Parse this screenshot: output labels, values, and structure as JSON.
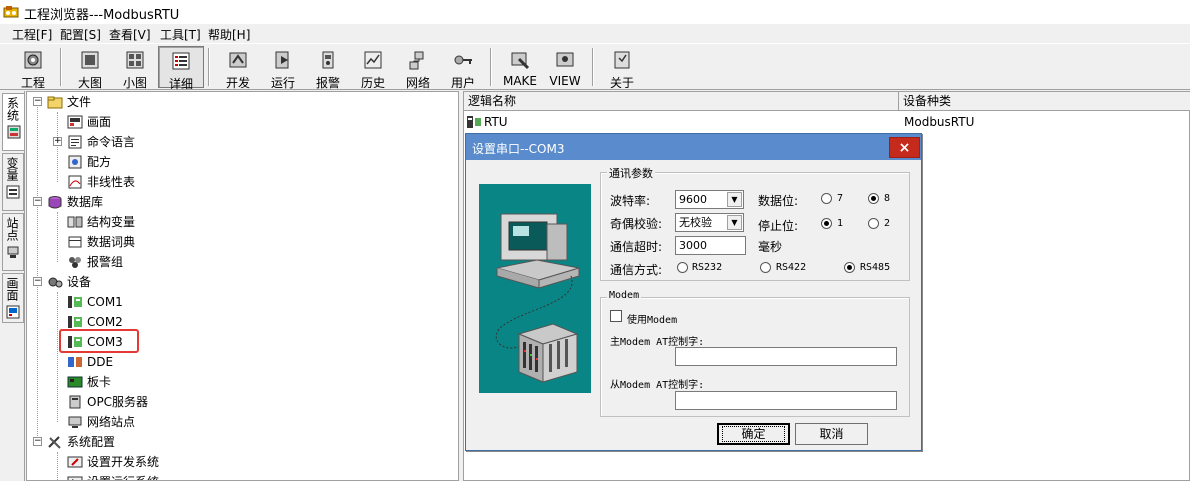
{
  "window": {
    "title": "工程浏览器---ModbusRTU",
    "app_icon": "app-logo-icon"
  },
  "menu": [
    "工程[F]",
    "配置[S]",
    "查看[V]",
    "工具[T]",
    "帮助[H]"
  ],
  "toolbar": {
    "buttons": [
      {
        "label": "工程",
        "icon": "project-icon"
      },
      {
        "label": "大图",
        "icon": "large-icons-icon"
      },
      {
        "label": "小图",
        "icon": "small-icons-icon"
      },
      {
        "label": "详细",
        "icon": "details-icon",
        "pressed": true
      },
      {
        "label": "开发",
        "icon": "develop-icon"
      },
      {
        "label": "运行",
        "icon": "run-icon"
      },
      {
        "label": "报警",
        "icon": "alarm-icon"
      },
      {
        "label": "历史",
        "icon": "history-icon"
      },
      {
        "label": "网络",
        "icon": "network-icon"
      },
      {
        "label": "用户",
        "icon": "user-key-icon"
      },
      {
        "label": "MAKE",
        "icon": "make-icon"
      },
      {
        "label": "VIEW",
        "icon": "view-icon"
      },
      {
        "label": "关于",
        "icon": "about-icon"
      }
    ]
  },
  "vtabs": [
    {
      "label": "系统",
      "icon": "system-tab-icon",
      "active": true
    },
    {
      "label": "变量",
      "icon": "variable-tab-icon"
    },
    {
      "label": "站点",
      "icon": "station-tab-icon"
    },
    {
      "label": "画面",
      "icon": "screen-tab-icon"
    }
  ],
  "tree": {
    "items": [
      {
        "label": "文件",
        "icon": "folder-icon",
        "level": 0,
        "expander": "−"
      },
      {
        "label": "画面",
        "icon": "screen-icon",
        "level": 1
      },
      {
        "label": "命令语言",
        "icon": "command-language-icon",
        "level": 1,
        "expander": "+"
      },
      {
        "label": "配方",
        "icon": "recipe-icon",
        "level": 1
      },
      {
        "label": "非线性表",
        "icon": "nonlinear-table-icon",
        "level": 1
      },
      {
        "label": "数据库",
        "icon": "database-icon",
        "level": 0,
        "expander": "−"
      },
      {
        "label": "结构变量",
        "icon": "struct-variable-icon",
        "level": 1
      },
      {
        "label": "数据词典",
        "icon": "data-dictionary-icon",
        "level": 1
      },
      {
        "label": "报警组",
        "icon": "alarm-group-icon",
        "level": 1
      },
      {
        "label": "设备",
        "icon": "device-icon",
        "level": 0,
        "expander": "−"
      },
      {
        "label": "COM1",
        "icon": "com-port-icon",
        "level": 1
      },
      {
        "label": "COM2",
        "icon": "com-port-icon",
        "level": 1
      },
      {
        "label": "COM3",
        "icon": "com-port-icon",
        "level": 1,
        "highlighted": true
      },
      {
        "label": "DDE",
        "icon": "dde-icon",
        "level": 1
      },
      {
        "label": "板卡",
        "icon": "board-card-icon",
        "level": 1
      },
      {
        "label": "OPC服务器",
        "icon": "opc-server-icon",
        "level": 1
      },
      {
        "label": "网络站点",
        "icon": "network-station-icon",
        "level": 1
      },
      {
        "label": "系统配置",
        "icon": "tools-icon",
        "level": 0,
        "expander": "−"
      },
      {
        "label": "设置开发系统",
        "icon": "dev-settings-icon",
        "level": 1
      },
      {
        "label": "设置运行系统",
        "icon": "run-settings-icon",
        "level": 1
      }
    ]
  },
  "list": {
    "columns": [
      "逻辑名称",
      "设备种类"
    ],
    "rows": [
      {
        "name": "RTU",
        "type": "ModbusRTU",
        "icon": "device-rtu-icon"
      }
    ]
  },
  "dialog": {
    "title": "设置串口--COM3",
    "close_label": "×",
    "comm_group": {
      "title": "通讯参数",
      "baud_label": "波特率:",
      "baud_value": "9600",
      "parity_label": "奇偶校验:",
      "parity_value": "无校验",
      "timeout_label": "通信超时:",
      "timeout_value": "3000",
      "timeout_unit": "毫秒",
      "mode_label": "通信方式:",
      "modes": [
        {
          "label": "RS232",
          "selected": false
        },
        {
          "label": "RS422",
          "selected": false
        },
        {
          "label": "RS485",
          "selected": true
        }
      ],
      "databits_label": "数据位:",
      "databits": [
        {
          "label": "7",
          "selected": false
        },
        {
          "label": "8",
          "selected": true
        }
      ],
      "stopbits_label": "停止位:",
      "stopbits": [
        {
          "label": "1",
          "selected": true
        },
        {
          "label": "2",
          "selected": false
        }
      ]
    },
    "modem_group": {
      "title": "Modem",
      "use_modem_label": "使用Modem",
      "use_modem_checked": false,
      "master_label": "主Modem AT控制字:",
      "master_value": "",
      "slave_label": "从Modem AT控制字:",
      "slave_value": ""
    },
    "ok_label": "确定",
    "cancel_label": "取消"
  }
}
